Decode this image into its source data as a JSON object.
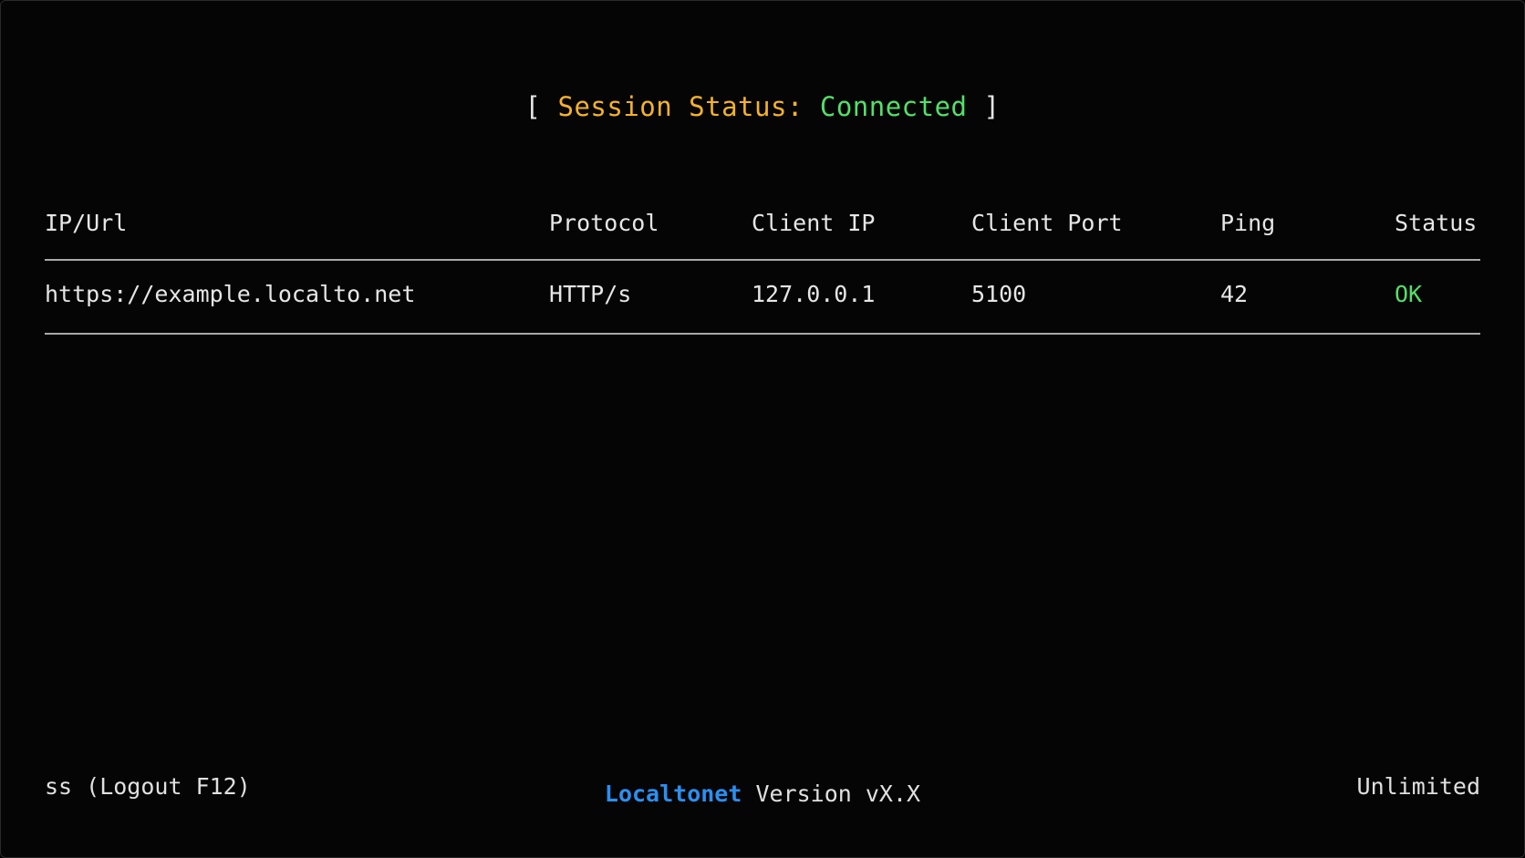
{
  "session": {
    "open_bracket": "[",
    "label": "Session Status:",
    "value": "Connected",
    "close_bracket": "]",
    "label_color": "#f4b22a",
    "value_color": "#52e06a"
  },
  "table": {
    "headers": [
      "IP/Url",
      "Protocol",
      "Client IP",
      "Client Port",
      "Ping",
      "Status"
    ],
    "rows": [
      {
        "url": "https://example.localto.net",
        "protocol": "HTTP/s",
        "client_ip": "127.0.0.1",
        "client_port": "5100",
        "ping": "42",
        "status": "OK"
      }
    ]
  },
  "footer": {
    "left": "ss (Logout F12)",
    "brand": "Localtonet",
    "version": "Version vX.X",
    "right": "Unlimited",
    "brand_color": "#2b8ff0"
  }
}
